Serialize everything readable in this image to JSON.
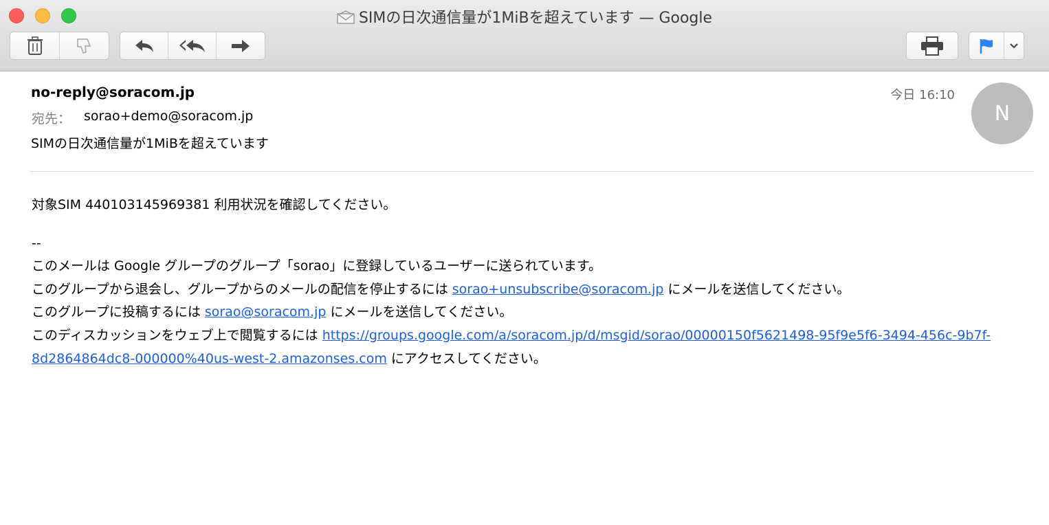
{
  "window": {
    "title": "SIMの日次通信量が1MiBを超えています — Google"
  },
  "toolbar": {
    "delete": "trash-icon",
    "junk": "thumbs-down-icon",
    "reply": "reply-icon",
    "reply_all": "reply-all-icon",
    "forward": "forward-icon",
    "print": "printer-icon",
    "flag": "flag-icon",
    "flag_color": "#2b84f5",
    "flag_menu": "chevron-down-icon"
  },
  "message": {
    "from": "no-reply@soracom.jp",
    "date": "今日 16:10",
    "to_label": "宛先：",
    "to": "sorao+demo@soracom.jp",
    "subject": "SIMの日次通信量が1MiBを超えています",
    "avatar_initial": "N",
    "body": {
      "line1": "対象SIM 440103145969381 利用状況を確認してください。",
      "dashes": "--",
      "line2": "このメールは Google グループのグループ「sorao」に登録しているユーザーに送られています。",
      "line3_pre": "このグループから退会し、グループからのメールの配信を停止するには ",
      "line3_link": "sorao+unsubscribe@soracom.jp",
      "line3_post": " にメールを送信してください。",
      "line4_pre": "このグループに投稿するには ",
      "line4_link": "sorao@soracom.jp",
      "line4_post": " にメールを送信してください。",
      "line5_pre": "このディスカッションをウェブ上で閲覧するには ",
      "line5_link": "https://groups.google.com/a/soracom.jp/d/msgid/sorao/00000150f5621498-95f9e5f6-3494-456c-9b7f-8d2864864dc8-000000%40us-west-2.amazonses.com",
      "line5_post": " にアクセスしてください。"
    }
  }
}
